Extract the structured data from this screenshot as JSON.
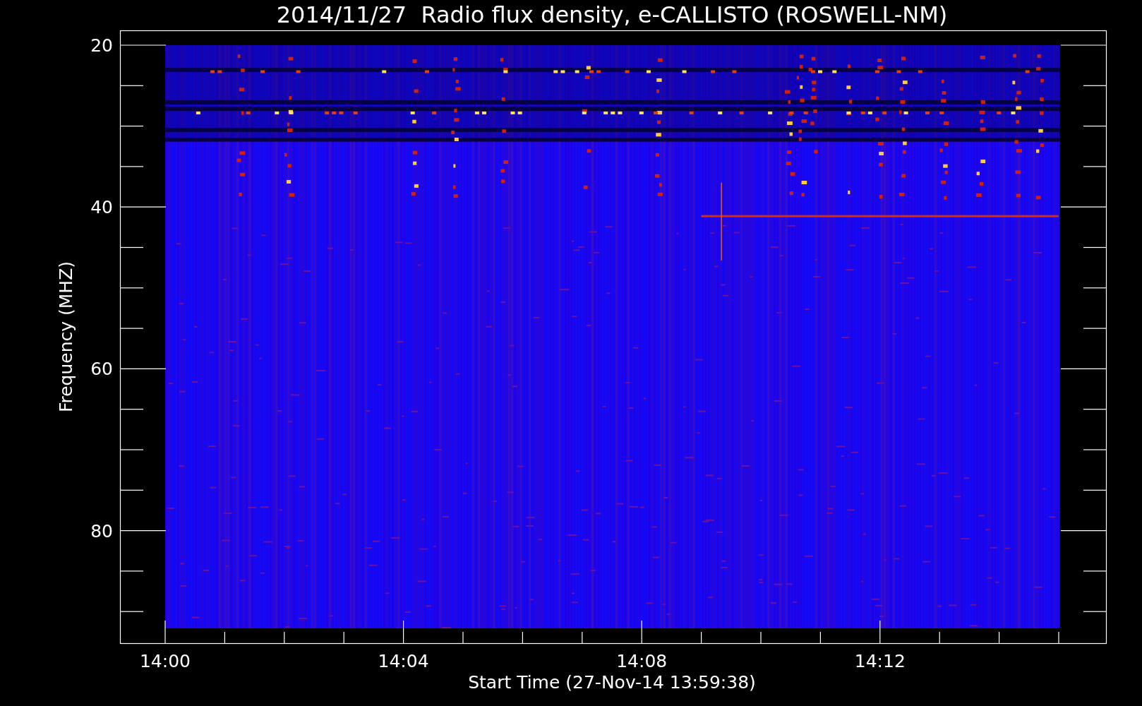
{
  "title": "2014/11/27  Radio flux density, e-CALLISTO (ROSWELL-NM)",
  "y_axis": {
    "label": "Frequency (MHZ)",
    "ticks": [
      "20",
      "40",
      "60",
      "80"
    ]
  },
  "x_axis": {
    "label": "Start Time (27-Nov-14 13:59:38)",
    "ticks": [
      "14:00",
      "14:04",
      "14:08",
      "14:12"
    ]
  }
}
